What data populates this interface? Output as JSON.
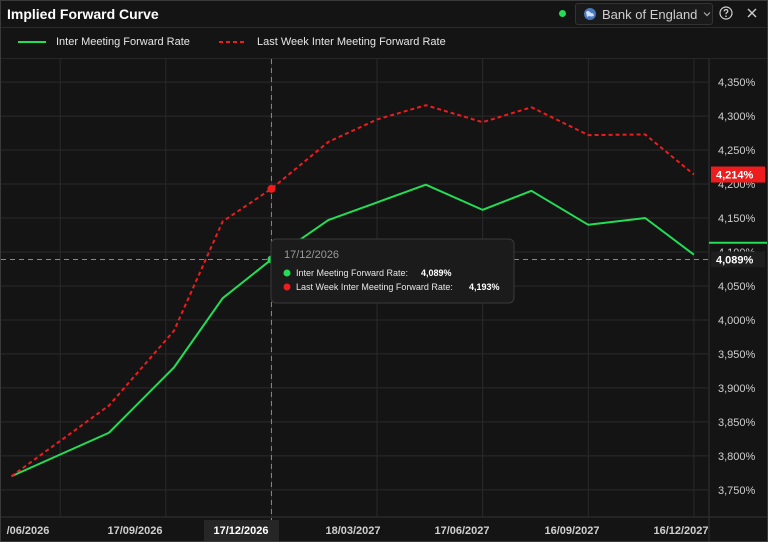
{
  "window": {
    "title": "Implied Forward Curve",
    "status_color": "#22dd55",
    "source_label": "Bank of England",
    "icons": [
      "globe-icon",
      "chevron-down-icon",
      "help-icon",
      "close-icon"
    ]
  },
  "colors": {
    "series_green": "#22dd55",
    "series_red": "#ee1c1c",
    "grid": "#2a2a2a",
    "crosshair": "#8a8a8a",
    "tooltip_bg": "#1b1b1b"
  },
  "tooltip": {
    "date": "17/12/2026",
    "rows": [
      {
        "label": "Inter Meeting Forward Rate:",
        "value": "4,089%"
      },
      {
        "label": "Last Week Inter Meeting Forward Rate:",
        "value": "4,193%"
      }
    ]
  },
  "chart_data": {
    "type": "line",
    "title": "Implied Forward Curve",
    "x": [
      "2026-05-07",
      "2026-07-30",
      "2026-09-24",
      "2026-11-05",
      "2026-12-17",
      "2027-02-04",
      "2027-03-18",
      "2027-04-29",
      "2027-06-17",
      "2027-07-29",
      "2027-09-16",
      "2027-11-04",
      "2027-12-16"
    ],
    "series": [
      {
        "name": "Inter Meeting Forward Rate",
        "color": "#22dd55",
        "style": "solid",
        "values": [
          3.77,
          3.834,
          3.93,
          4.032,
          4.089,
          4.147,
          4.173,
          4.199,
          4.162,
          4.19,
          4.14,
          4.15,
          4.096
        ]
      },
      {
        "name": "Last Week Inter Meeting Forward Rate",
        "color": "#ee1c1c",
        "style": "dashed",
        "values": [
          3.77,
          3.874,
          3.984,
          4.145,
          4.193,
          4.262,
          4.295,
          4.316,
          4.291,
          4.313,
          4.272,
          4.273,
          4.214
        ]
      }
    ],
    "x_tick_labels": [
      "/06/2026",
      "17/09/2026",
      "17/12/2026",
      "18/03/2027",
      "17/06/2027",
      "16/09/2027",
      "16/12/2027"
    ],
    "y_tick_labels": [
      "3,750%",
      "3,800%",
      "3,850%",
      "3,900%",
      "3,950%",
      "4,000%",
      "4,050%",
      "4,100%",
      "4,150%",
      "4,200%",
      "4,250%",
      "4,300%",
      "4,350%"
    ],
    "y_ticks": [
      3.75,
      3.8,
      3.85,
      3.9,
      3.95,
      4.0,
      4.05,
      4.1,
      4.15,
      4.2,
      4.25,
      4.3,
      4.35
    ],
    "ylim": [
      3.71,
      4.384
    ],
    "xlim": [
      "2026-04-28",
      "2027-12-29"
    ],
    "y_axis_side": "right",
    "hover_x": "2026-12-17",
    "hover_y": 4.089,
    "last_value_labels": [
      "4,214%",
      "4,089%"
    ],
    "grid": true
  }
}
